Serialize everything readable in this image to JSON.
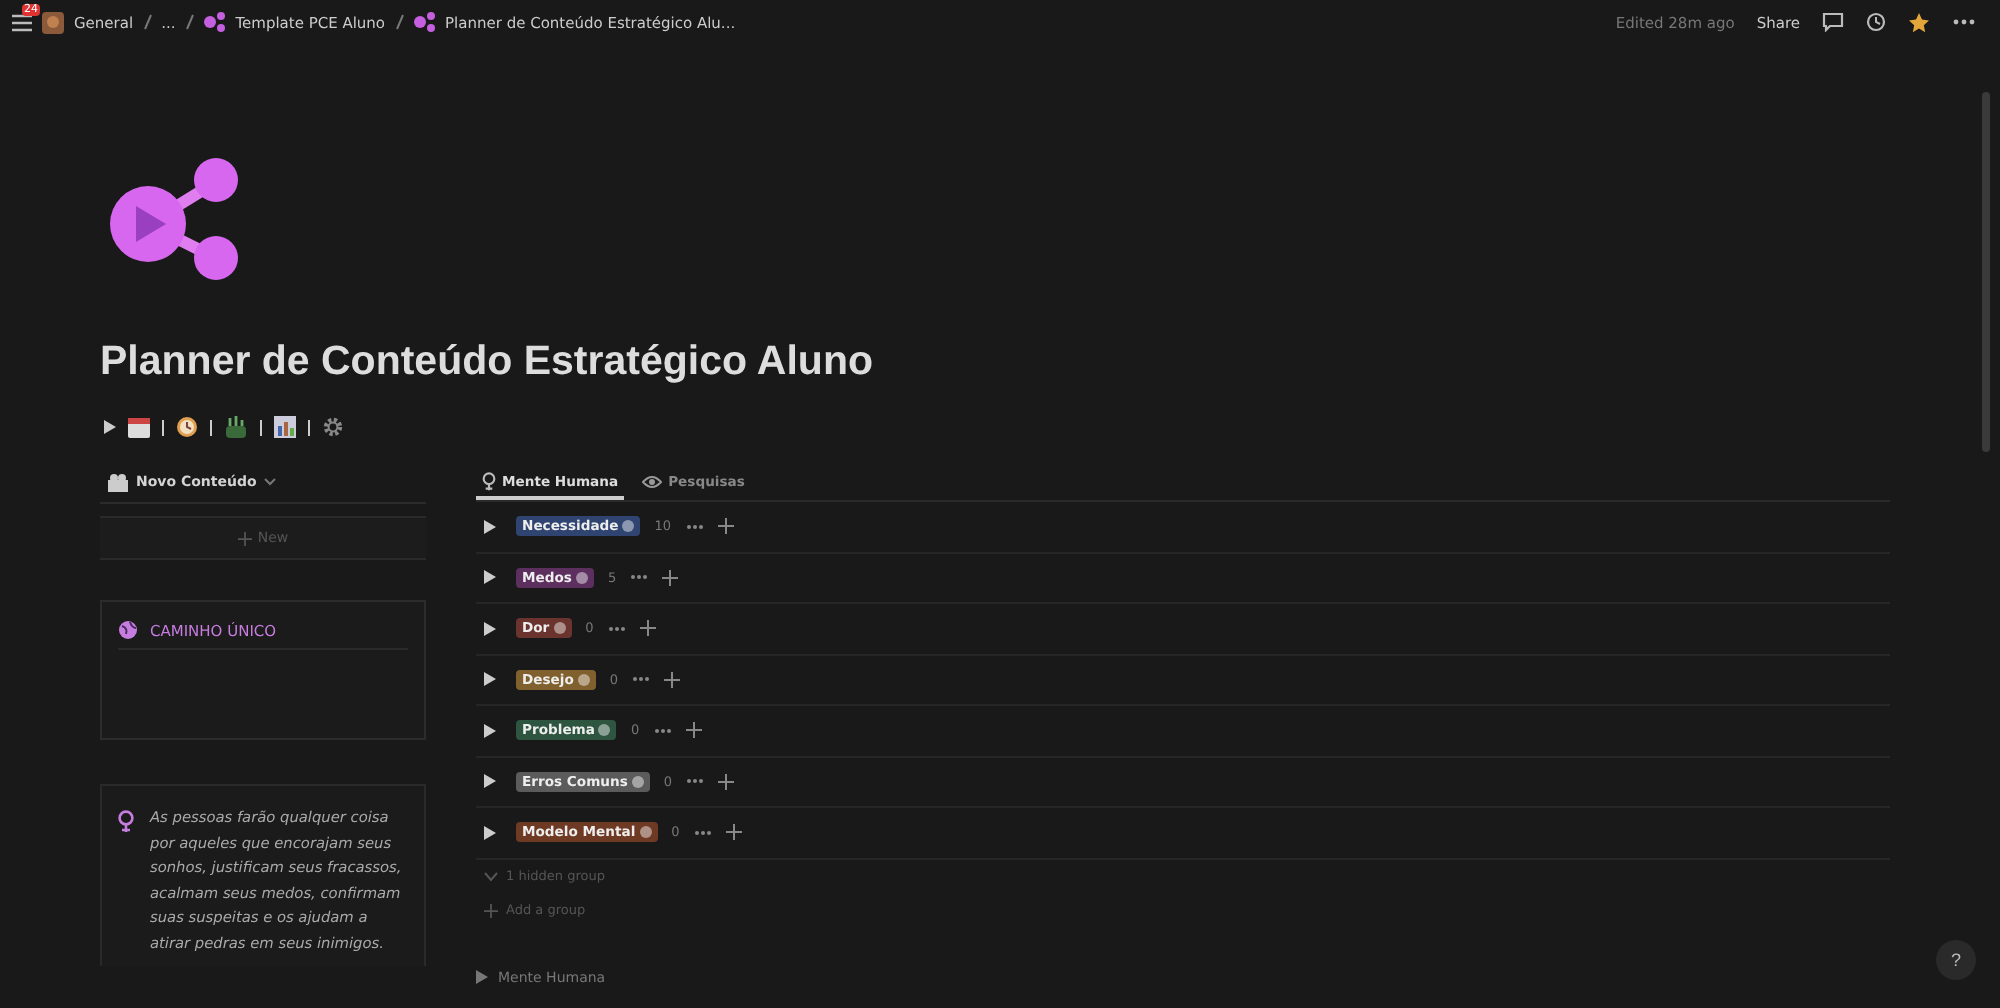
{
  "topbar": {
    "notification_count": "24",
    "breadcrumbs": [
      "General",
      "...",
      "Template PCE Aluno",
      "Planner de Conteúdo Estratégico Alu..."
    ],
    "edited": "Edited 28m ago",
    "share": "Share"
  },
  "page": {
    "title": "Planner de Conteúdo Estratégico Aluno"
  },
  "left": {
    "view": "Novo Conteúdo",
    "new": "New",
    "callout": "CAMINHO ÚNICO",
    "quote": "As pessoas farão qualquer coisa por aqueles que encorajam seus sonhos, justificam seus fracassos, acalmam seus medos, confirmam suas suspeitas e os ajudam a atirar pedras em seus inimigos."
  },
  "tabs": [
    {
      "label": "Mente Humana",
      "selected": true
    },
    {
      "label": "Pesquisas",
      "selected": false
    }
  ],
  "groups": [
    {
      "label": "Necessidade",
      "color": "#2f4470",
      "count": "10"
    },
    {
      "label": "Medos",
      "color": "#5c2f5e",
      "count": "5"
    },
    {
      "label": "Dor",
      "color": "#6b332e",
      "count": "0"
    },
    {
      "label": "Desejo",
      "color": "#80602c",
      "count": "0"
    },
    {
      "label": "Problema",
      "color": "#2d5540",
      "count": "0"
    },
    {
      "label": "Erros Comuns",
      "color": "#5b5b5b",
      "count": "0"
    },
    {
      "label": "Modelo Mental",
      "color": "#6e3a24",
      "count": "0"
    }
  ],
  "hidden_groups": "1 hidden group",
  "add_group": "Add a group",
  "next_section": "Mente Humana",
  "help": "?"
}
